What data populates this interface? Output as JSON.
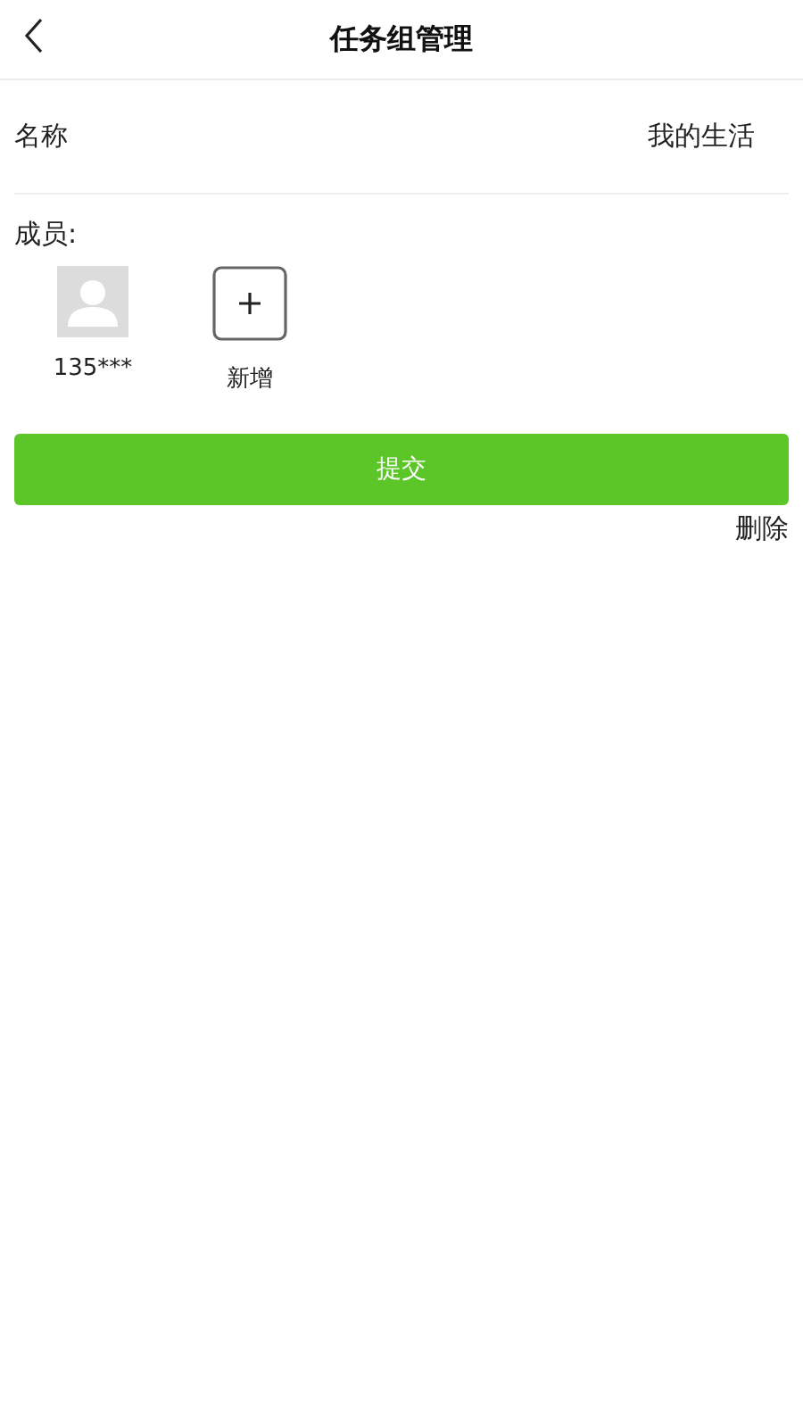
{
  "header": {
    "title": "任务组管理"
  },
  "name_row": {
    "label": "名称",
    "value": "我的生活"
  },
  "members": {
    "label": "成员:",
    "items": [
      {
        "kind": "member",
        "label": "135***"
      },
      {
        "kind": "add",
        "label": "新增"
      }
    ]
  },
  "submit_button": "提交",
  "delete_link": "删除"
}
